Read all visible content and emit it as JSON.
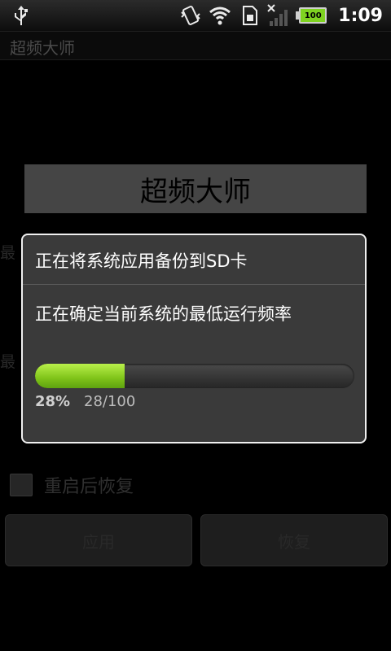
{
  "status_bar": {
    "time": "1:09",
    "battery_level": "100",
    "icons": [
      "usb-icon",
      "vibrate-icon",
      "wifi-icon",
      "sd-card-icon",
      "no-signal-icon",
      "battery-icon"
    ]
  },
  "app": {
    "title": "超频大师"
  },
  "background": {
    "heading": "超频大师",
    "fragment_1": "最",
    "fragment_2": "最",
    "checkbox_label": "重启后恢复",
    "apply_button": "应用",
    "restore_button": "恢复"
  },
  "dialog": {
    "title": "正在将系统应用备份到SD卡",
    "message": "正在确定当前系统的最低运行频率",
    "progress_percent_text": "28%",
    "progress_count_text": "28/100",
    "progress_value": 28,
    "progress_max": 100
  },
  "colors": {
    "progress_fill": "#7fc319",
    "dialog_bg": "#3a3a3a",
    "dialog_border": "#f0f0f0"
  }
}
